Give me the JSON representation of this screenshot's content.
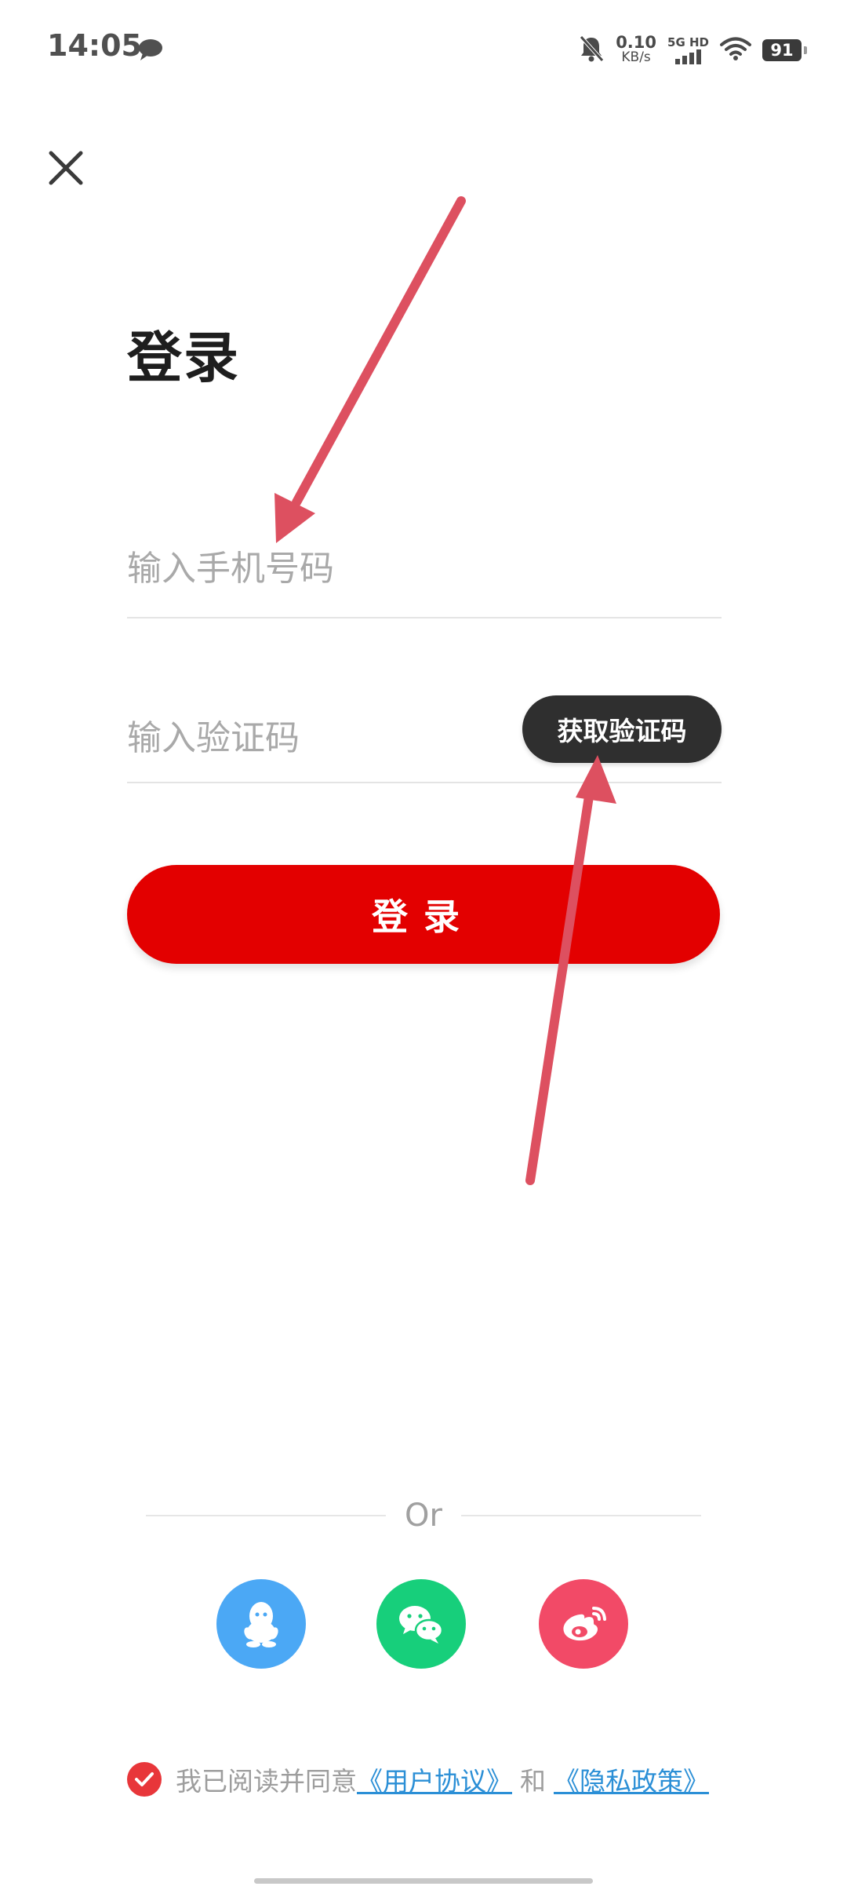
{
  "status_bar": {
    "time": "14:05",
    "net_speed_value": "0.10",
    "net_speed_unit": "KB/s",
    "network_label": "5G HD",
    "battery": "91"
  },
  "page": {
    "title": "登录"
  },
  "phone_input": {
    "placeholder": "输入手机号码",
    "value": ""
  },
  "code_input": {
    "placeholder": "输入验证码",
    "value": ""
  },
  "get_code_button": {
    "label": "获取验证码"
  },
  "login_button": {
    "label": "登录"
  },
  "divider": {
    "label": "Or"
  },
  "social": [
    {
      "name": "qq",
      "icon": "qq-icon",
      "color": "#4ba8f5"
    },
    {
      "name": "wechat",
      "icon": "wechat-icon",
      "color": "#17cf7b"
    },
    {
      "name": "weibo",
      "icon": "weibo-icon",
      "color": "#f24a67"
    }
  ],
  "agreement": {
    "checked": true,
    "prefix": "我已阅读并同意",
    "user_agreement": "《用户协议》",
    "conjunction": "和",
    "privacy_policy": "《隐私政策》"
  },
  "colors": {
    "accent": "#e30000",
    "dark_button": "#2f2f2f",
    "link": "#2b8fd6",
    "annotation_arrow": "#dd5060"
  }
}
